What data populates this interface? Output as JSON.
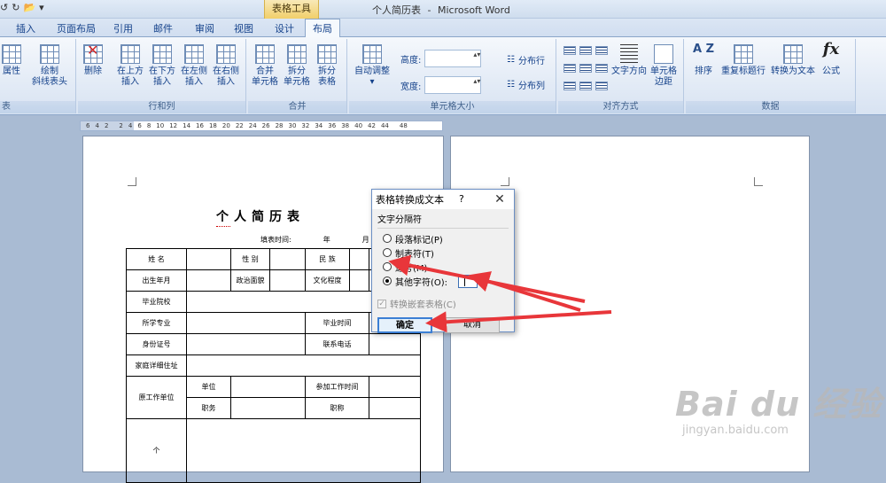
{
  "qat": {
    "undo": "↺",
    "redo": "↻",
    "open": "📂",
    "customize": "▾"
  },
  "window": {
    "context_tool": "表格工具",
    "doc_name": "个人简历表",
    "separator": "-",
    "app_name": "Microsoft Word"
  },
  "tabs": [
    {
      "label": "插入"
    },
    {
      "label": "页面布局"
    },
    {
      "label": "引用"
    },
    {
      "label": "邮件"
    },
    {
      "label": "审阅"
    },
    {
      "label": "视图"
    },
    {
      "label": "设计"
    },
    {
      "label": "布局"
    }
  ],
  "ribbon": {
    "table_group": {
      "caption": "表",
      "properties": "属性",
      "draw_diag": [
        "绘制",
        "斜线表头"
      ]
    },
    "rows_cols": {
      "caption": "行和列",
      "delete": "删除",
      "insert_above": [
        "在上方",
        "插入"
      ],
      "insert_below": [
        "在下方",
        "插入"
      ],
      "insert_left": [
        "在左侧",
        "插入"
      ],
      "insert_right": [
        "在右侧",
        "插入"
      ]
    },
    "merge": {
      "caption": "合并",
      "merge_cells": [
        "合并",
        "单元格"
      ],
      "split_cells": [
        "拆分",
        "单元格"
      ],
      "split_table": [
        "拆分",
        "表格"
      ]
    },
    "cell_size": {
      "caption": "单元格大小",
      "autofit": "自动调整",
      "height_label": "高度:",
      "width_label": "宽度:",
      "dist_rows": "分布行",
      "dist_cols": "分布列"
    },
    "alignment": {
      "caption": "对齐方式",
      "text_direction": "文字方向",
      "cell_margins": [
        "单元格",
        "边距"
      ]
    },
    "data": {
      "caption": "数据",
      "sort": "排序",
      "repeat_header": "重复标题行",
      "convert_to_text": "转换为文本",
      "formula": "公式",
      "sort_glyph": "A Z",
      "fx_glyph": "fx"
    }
  },
  "ruler": {
    "marks": [
      "6",
      "4",
      "2",
      "",
      "2",
      "4",
      "6",
      "8",
      "10",
      "12",
      "14",
      "16",
      "18",
      "20",
      "22",
      "24",
      "26",
      "28",
      "30",
      "32",
      "34",
      "36",
      "38",
      "40",
      "42",
      "44",
      "",
      "48"
    ]
  },
  "document": {
    "heading": "个人简历表",
    "fill_time": "填表时间:",
    "year": "年",
    "month": "月",
    "table": {
      "name": "姓 名",
      "gender": "性 别",
      "ethnicity": "民 族",
      "birth": "出生年月",
      "political": "政治面貌",
      "education": "文化程度",
      "school": "毕业院校",
      "major": "所学专业",
      "grad_time": "毕业时间",
      "id": "身份证号",
      "phone": "联系电话",
      "address": "家庭详细住址",
      "prev_unit": "原工作单位",
      "unit": "单位",
      "work_time": "参加工作时间",
      "position": "职务",
      "title": "职称",
      "personal": "个"
    }
  },
  "dialog": {
    "title": "表格转换成文本",
    "help": "?",
    "close": "✕",
    "section": "文字分隔符",
    "options": [
      {
        "label": "段落标记(P)",
        "selected": false
      },
      {
        "label": "制表符(T)",
        "selected": false
      },
      {
        "label": "逗号(M)",
        "selected": false
      },
      {
        "label": "其他字符(O):",
        "selected": true
      }
    ],
    "other_value": "",
    "nested_label": "转换嵌套表格(C)",
    "nested_checked": true,
    "ok": "确定",
    "cancel": "取消"
  },
  "colors": {
    "arrow": "#e8363a",
    "ribbon_text": "#15428b"
  },
  "watermark": {
    "brand": "Bai du 经验",
    "url": "jingyan.baidu.com"
  }
}
